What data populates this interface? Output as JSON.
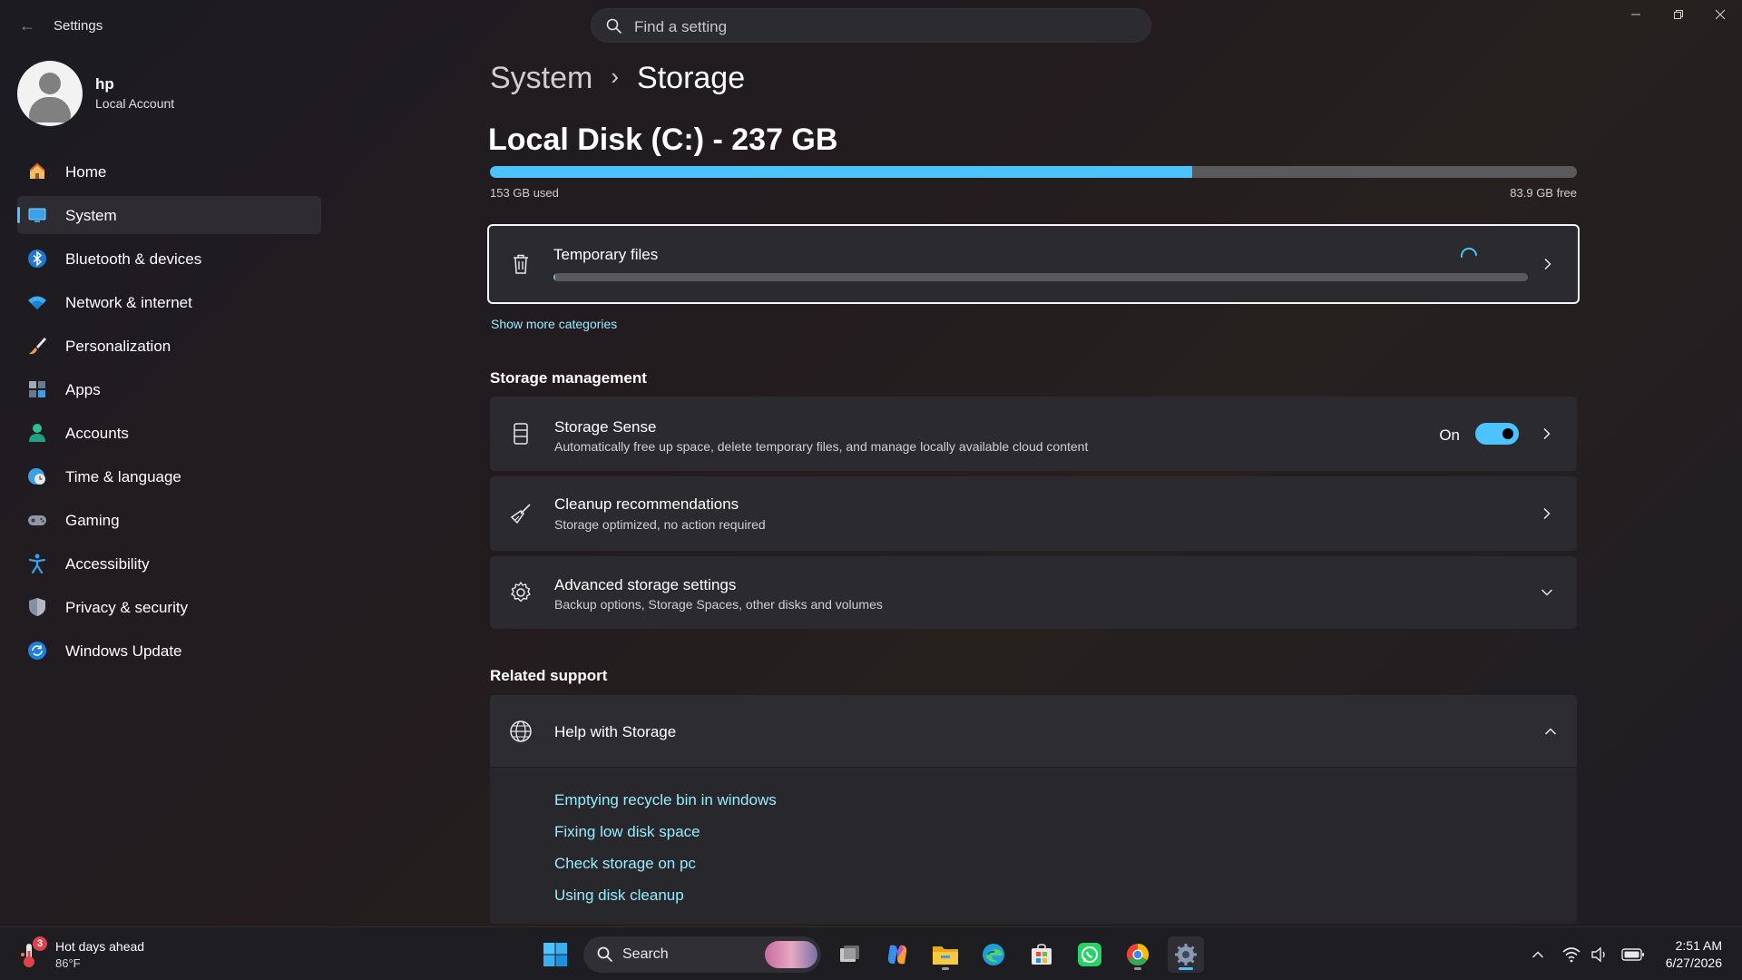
{
  "window": {
    "title": "Settings",
    "back_label": "←"
  },
  "search": {
    "placeholder": "Find a setting"
  },
  "profile": {
    "name": "hp",
    "account_type": "Local Account"
  },
  "sidebar": {
    "items": [
      {
        "label": "Home",
        "icon": "home-icon",
        "active": false
      },
      {
        "label": "System",
        "icon": "system-icon",
        "active": true
      },
      {
        "label": "Bluetooth & devices",
        "icon": "bluetooth-icon",
        "active": false
      },
      {
        "label": "Network & internet",
        "icon": "wifi-icon",
        "active": false
      },
      {
        "label": "Personalization",
        "icon": "brush-icon",
        "active": false
      },
      {
        "label": "Apps",
        "icon": "apps-icon",
        "active": false
      },
      {
        "label": "Accounts",
        "icon": "accounts-icon",
        "active": false
      },
      {
        "label": "Time & language",
        "icon": "globe-clock-icon",
        "active": false
      },
      {
        "label": "Gaming",
        "icon": "gamepad-icon",
        "active": false
      },
      {
        "label": "Accessibility",
        "icon": "accessibility-icon",
        "active": false
      },
      {
        "label": "Privacy & security",
        "icon": "shield-icon",
        "active": false
      },
      {
        "label": "Windows Update",
        "icon": "update-icon",
        "active": false
      }
    ]
  },
  "breadcrumb": {
    "parent": "System",
    "separator": "›",
    "current": "Storage"
  },
  "disk": {
    "title": "Local Disk (C:) - 237 GB",
    "used_label": "153 GB used",
    "free_label": "83.9 GB free",
    "used_fraction": 0.646
  },
  "temp_files": {
    "title": "Temporary files",
    "progress_fraction": 0.002
  },
  "show_more": "Show more categories",
  "storage_management": {
    "heading": "Storage management",
    "storage_sense": {
      "title": "Storage Sense",
      "subtitle": "Automatically free up space, delete temporary files, and manage locally available cloud content",
      "toggle_label": "On",
      "toggle_on": true
    },
    "cleanup": {
      "title": "Cleanup recommendations",
      "subtitle": "Storage optimized, no action required"
    },
    "advanced": {
      "title": "Advanced storage settings",
      "subtitle": "Backup options, Storage Spaces, other disks and volumes"
    }
  },
  "related_support": {
    "heading": "Related support",
    "help_title": "Help with Storage",
    "links": [
      "Emptying recycle bin in windows",
      "Fixing low disk space",
      "Check storage on pc",
      "Using disk cleanup"
    ]
  },
  "taskbar": {
    "weather_title": "Hot days ahead",
    "weather_temp": "86°F",
    "weather_badge": "3",
    "search_placeholder": "Search",
    "time": "2:51 AM",
    "date": "6/27/2026"
  },
  "colors": {
    "accent": "#4cc2ff",
    "link": "#99ebff",
    "card": "#2b2a2e",
    "track": "#5a595c"
  }
}
